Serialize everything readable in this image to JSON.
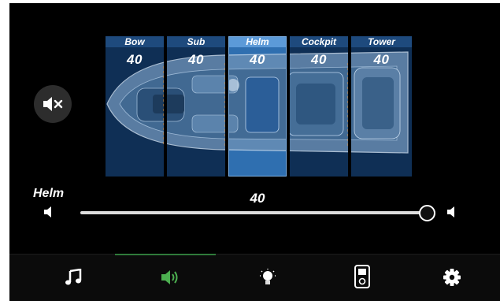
{
  "zones": [
    {
      "name": "Bow",
      "value": "40"
    },
    {
      "name": "Sub",
      "value": "40"
    },
    {
      "name": "Helm",
      "value": "40"
    },
    {
      "name": "Cockpit",
      "value": "40"
    },
    {
      "name": "Tower",
      "value": "40"
    }
  ],
  "selected_zone": {
    "name": "Helm",
    "value": "40",
    "slider_fraction": 1.0
  },
  "tabs": [
    {
      "name": "music",
      "icon": "music-note-icon"
    },
    {
      "name": "audio",
      "icon": "speaker-icon",
      "active": true
    },
    {
      "name": "lights",
      "icon": "light-bulb-icon"
    },
    {
      "name": "device",
      "icon": "ipod-icon"
    },
    {
      "name": "settings",
      "icon": "gear-icon"
    }
  ],
  "colors": {
    "zone_active": "#2f6fb0",
    "zone_inactive": "#0f2f55",
    "active_tab_icon": "#4caf50",
    "active_tab_indicator": "#2f7a3a"
  }
}
